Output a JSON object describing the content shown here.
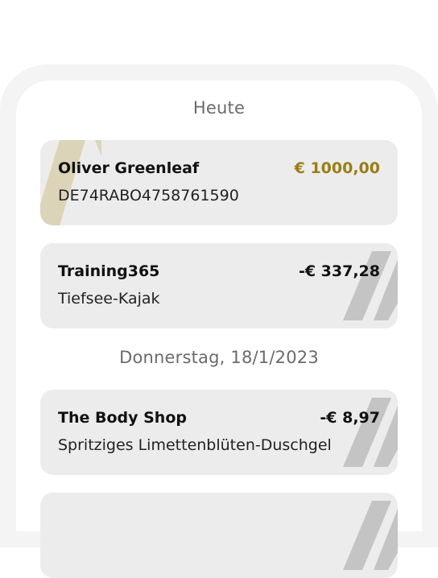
{
  "sections": [
    {
      "label": "Heute"
    },
    {
      "label": "Donnerstag, 18/1/2023"
    }
  ],
  "transactions": [
    {
      "name": "Oliver Greenleaf",
      "detail": "DE74RABO4758761590",
      "amount": "€ 1000,00",
      "direction": "incoming"
    },
    {
      "name": "Training365",
      "detail": "Tiefsee-Kajak",
      "amount": "-€ 337,28",
      "direction": "outgoing"
    },
    {
      "name": "The Body Shop",
      "detail": "Spritziges Limettenblüten-Duschgel",
      "amount": "-€ 8,97",
      "direction": "outgoing"
    }
  ],
  "colors": {
    "incoming_amount": "#9a7d14",
    "incoming_decor": "#dcd4b8",
    "outgoing_decor": "#c4c4c4",
    "card_background": "#ececec"
  },
  "icons": {
    "incoming": "slash-stripes-icon",
    "outgoing": "slash-stripes-icon"
  }
}
